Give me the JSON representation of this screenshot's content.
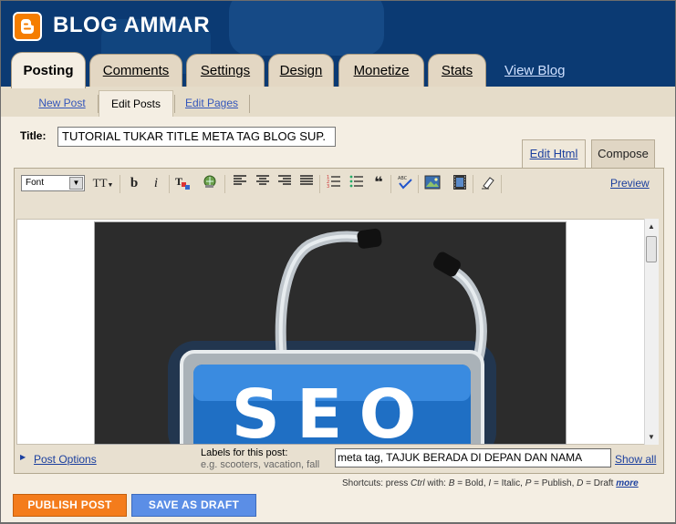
{
  "header": {
    "blog_title": "BLOG AMMAR",
    "logo_icon": "blogger-logo-icon"
  },
  "main_tabs": [
    {
      "label": "Posting",
      "active": true
    },
    {
      "label": "Comments",
      "active": false
    },
    {
      "label": "Settings",
      "active": false
    },
    {
      "label": "Design",
      "active": false
    },
    {
      "label": "Monetize",
      "active": false
    },
    {
      "label": "Stats",
      "active": false
    }
  ],
  "view_blog_label": "View Blog",
  "sub_tabs": [
    {
      "label": "New Post",
      "active": false
    },
    {
      "label": "Edit Posts",
      "active": true
    },
    {
      "label": "Edit Pages",
      "active": false
    }
  ],
  "post": {
    "title_label": "Title:",
    "title_value": "TUTORIAL TUKAR TITLE META TAG BLOG SUP."
  },
  "editor_modes": {
    "edit_html": "Edit Html",
    "compose": "Compose",
    "active": "compose"
  },
  "toolbar": {
    "font_label": "Font",
    "font_size_label": "TT",
    "bold_label": "b",
    "italic_label": "i",
    "preview_label": "Preview",
    "icons": [
      "font-size-icon",
      "bold-icon",
      "italic-icon",
      "text-color-icon",
      "link-icon",
      "align-left-icon",
      "align-center-icon",
      "align-right-icon",
      "align-justify-icon",
      "numbered-list-icon",
      "bullet-list-icon",
      "blockquote-icon",
      "spell-check-icon",
      "insert-image-icon",
      "insert-video-icon",
      "remove-formatting-icon"
    ]
  },
  "image": {
    "text": "SEO"
  },
  "options": {
    "post_options_label": "Post Options",
    "labels_title": "Labels for this post:",
    "labels_hint": "e.g. scooters, vacation, fall",
    "labels_value": "meta tag, TAJUK BERADA DI DEPAN DAN NAMA",
    "show_all_label": "Show all"
  },
  "shortcuts": {
    "prefix": "Shortcuts: press",
    "ctrl": "Ctrl",
    "with": "with:",
    "b_key": "B",
    "b_text": "= Bold,",
    "i_key": "I",
    "i_text": "= Italic,",
    "p_key": "P",
    "p_text": "= Publish,",
    "d_key": "D",
    "d_text": "= Draft",
    "more": "more"
  },
  "buttons": {
    "publish": "PUBLISH POST",
    "save_draft": "SAVE AS DRAFT"
  },
  "colors": {
    "header_bg": "#0b3a73",
    "tab_bg": "#e3d7c3",
    "content_bg": "#f4eee3",
    "publish": "#f47c1c",
    "draft": "#5b8ee6",
    "link": "#1b3f9e"
  }
}
